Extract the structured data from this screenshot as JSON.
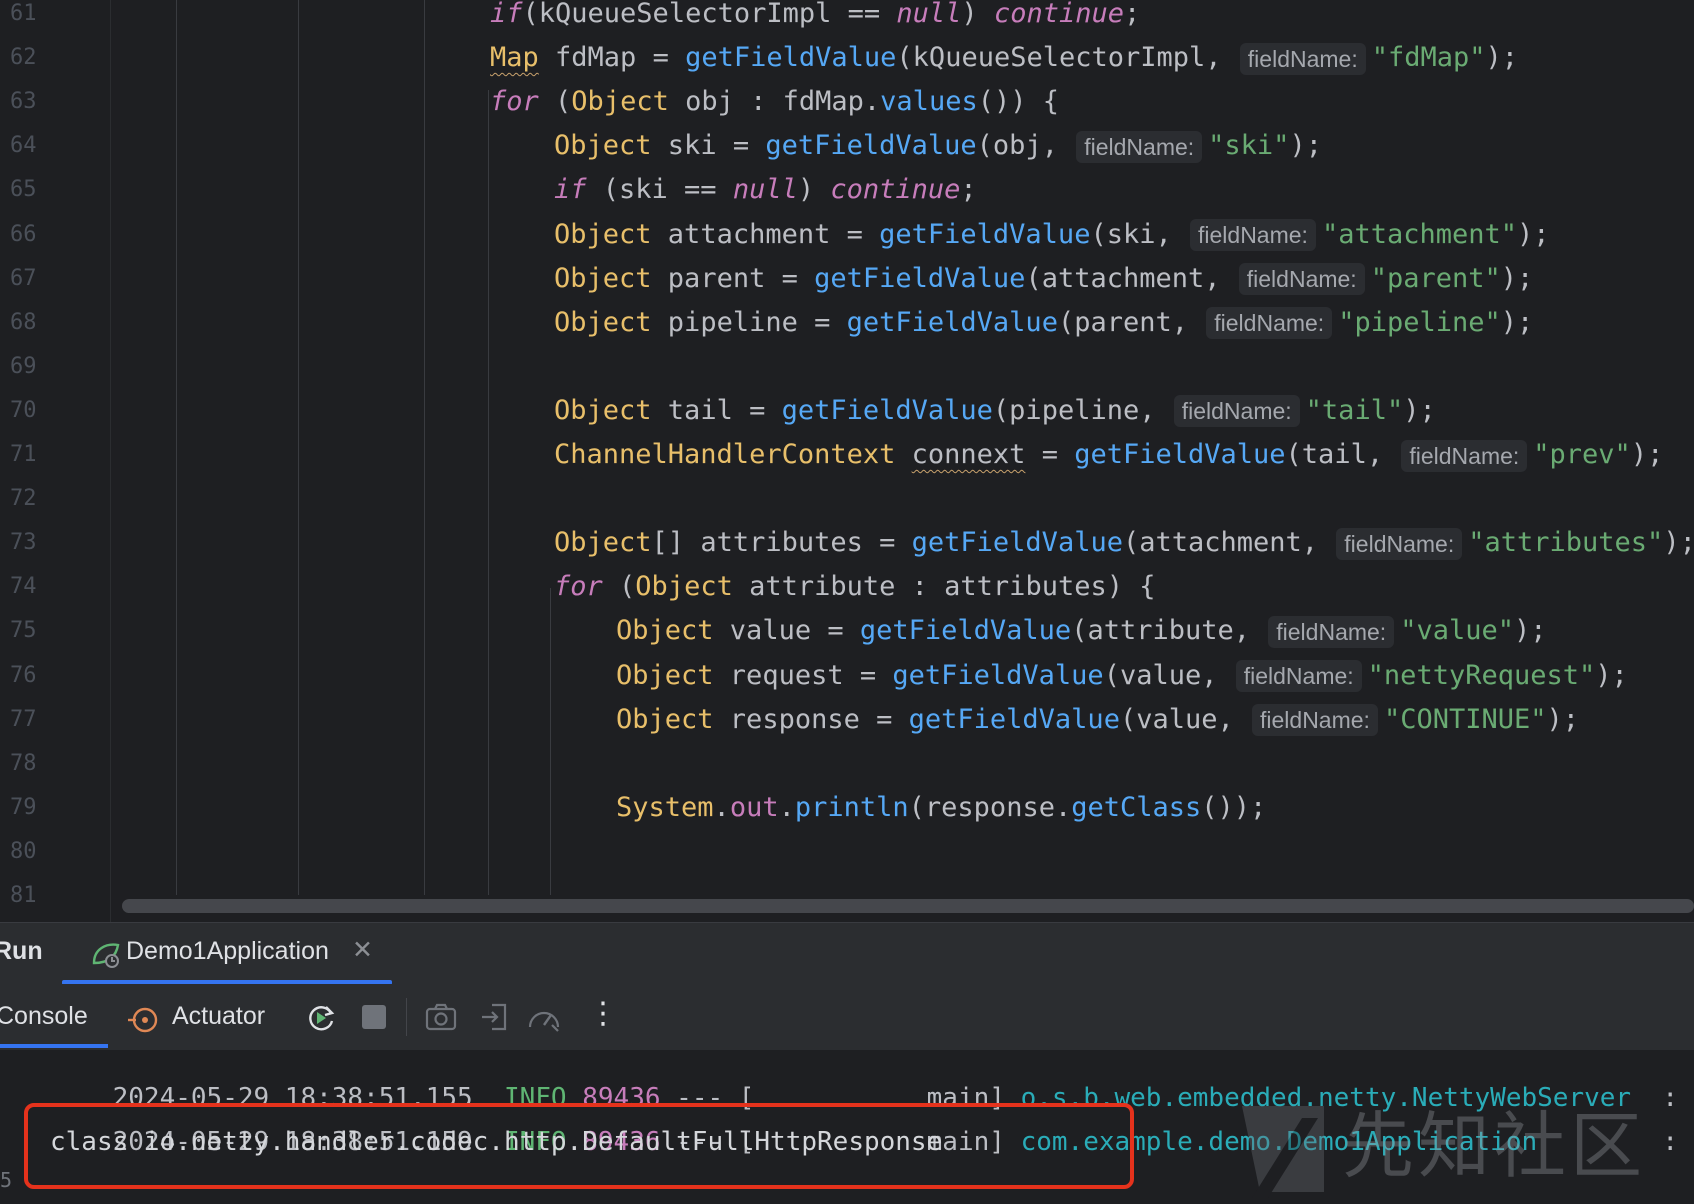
{
  "editor": {
    "lines": [
      {
        "n": "61",
        "parts": [
          [
            "ikw",
            "if"
          ],
          [
            "",
            "(kQueueSelectorImpl == "
          ],
          [
            "ikw",
            "null"
          ],
          [
            "",
            ") "
          ],
          [
            "ikw",
            "continue"
          ],
          [
            "",
            ";"
          ]
        ],
        "indent": 3
      },
      {
        "n": "62",
        "parts": [
          [
            "typ squig",
            "Map"
          ],
          [
            "",
            " fdMap = "
          ],
          [
            "fn",
            "getFieldValue"
          ],
          [
            "",
            "(kQueueSelectorImpl, "
          ],
          [
            "hint",
            "fieldName:"
          ],
          [
            "str",
            "\"fdMap\""
          ],
          [
            "",
            ");"
          ]
        ],
        "indent": 3
      },
      {
        "n": "63",
        "parts": [
          [
            "ikw",
            "for"
          ],
          [
            "",
            " ("
          ],
          [
            "typ",
            "Object"
          ],
          [
            "",
            " obj : fdMap."
          ],
          [
            "fn",
            "values"
          ],
          [
            "",
            "()) {"
          ]
        ],
        "indent": 3
      },
      {
        "n": "64",
        "parts": [
          [
            "typ",
            "Object"
          ],
          [
            "",
            " ski = "
          ],
          [
            "fn",
            "getFieldValue"
          ],
          [
            "",
            "(obj, "
          ],
          [
            "hint",
            "fieldName:"
          ],
          [
            "str",
            "\"ski\""
          ],
          [
            "",
            ");"
          ]
        ],
        "indent": 4
      },
      {
        "n": "65",
        "parts": [
          [
            "ikw",
            "if"
          ],
          [
            "",
            " (ski == "
          ],
          [
            "ikw",
            "null"
          ],
          [
            "",
            ") "
          ],
          [
            "ikw",
            "continue"
          ],
          [
            "",
            ";"
          ]
        ],
        "indent": 4
      },
      {
        "n": "66",
        "parts": [
          [
            "typ",
            "Object"
          ],
          [
            "",
            " attachment = "
          ],
          [
            "fn",
            "getFieldValue"
          ],
          [
            "",
            "(ski, "
          ],
          [
            "hint",
            "fieldName:"
          ],
          [
            "str",
            "\"attachment\""
          ],
          [
            "",
            ");"
          ]
        ],
        "indent": 4
      },
      {
        "n": "67",
        "parts": [
          [
            "typ",
            "Object"
          ],
          [
            "",
            " parent = "
          ],
          [
            "fn",
            "getFieldValue"
          ],
          [
            "",
            "(attachment, "
          ],
          [
            "hint",
            "fieldName:"
          ],
          [
            "str",
            "\"parent\""
          ],
          [
            "",
            ");"
          ]
        ],
        "indent": 4
      },
      {
        "n": "68",
        "parts": [
          [
            "typ",
            "Object"
          ],
          [
            "",
            " pipeline = "
          ],
          [
            "fn",
            "getFieldValue"
          ],
          [
            "",
            "(parent, "
          ],
          [
            "hint",
            "fieldName:"
          ],
          [
            "str",
            "\"pipeline\""
          ],
          [
            "",
            ");"
          ]
        ],
        "indent": 4
      },
      {
        "n": "69",
        "parts": [],
        "indent": 4
      },
      {
        "n": "70",
        "parts": [
          [
            "typ",
            "Object"
          ],
          [
            "",
            " tail = "
          ],
          [
            "fn",
            "getFieldValue"
          ],
          [
            "",
            "(pipeline, "
          ],
          [
            "hint",
            "fieldName:"
          ],
          [
            "str",
            "\"tail\""
          ],
          [
            "",
            ");"
          ]
        ],
        "indent": 4
      },
      {
        "n": "71",
        "parts": [
          [
            "typ",
            "ChannelHandlerContext"
          ],
          [
            "",
            " "
          ],
          [
            "squig",
            "connext"
          ],
          [
            "",
            " = "
          ],
          [
            "fn",
            "getFieldValue"
          ],
          [
            "",
            "(tail, "
          ],
          [
            "hint",
            "fieldName:"
          ],
          [
            "str",
            "\"prev\""
          ],
          [
            "",
            ");"
          ]
        ],
        "indent": 4
      },
      {
        "n": "72",
        "parts": [],
        "indent": 4
      },
      {
        "n": "73",
        "parts": [
          [
            "typ",
            "Object"
          ],
          [
            "",
            "[] attributes = "
          ],
          [
            "fn",
            "getFieldValue"
          ],
          [
            "",
            "(attachment, "
          ],
          [
            "hint",
            "fieldName:"
          ],
          [
            "str",
            "\"attributes\""
          ],
          [
            "",
            ");"
          ]
        ],
        "indent": 4
      },
      {
        "n": "74",
        "parts": [
          [
            "ikw",
            "for"
          ],
          [
            "",
            " ("
          ],
          [
            "typ",
            "Object"
          ],
          [
            "",
            " attribute : attributes) {"
          ]
        ],
        "indent": 4
      },
      {
        "n": "75",
        "parts": [
          [
            "typ",
            "Object"
          ],
          [
            "",
            " value = "
          ],
          [
            "fn",
            "getFieldValue"
          ],
          [
            "",
            "(attribute, "
          ],
          [
            "hint",
            "fieldName:"
          ],
          [
            "str",
            "\"value\""
          ],
          [
            "",
            ");"
          ]
        ],
        "indent": 5
      },
      {
        "n": "76",
        "parts": [
          [
            "typ",
            "Object"
          ],
          [
            "",
            " request = "
          ],
          [
            "fn",
            "getFieldValue"
          ],
          [
            "",
            "(value, "
          ],
          [
            "hint",
            "fieldName:"
          ],
          [
            "str",
            "\"nettyRequest\""
          ],
          [
            "",
            ");"
          ]
        ],
        "indent": 5
      },
      {
        "n": "77",
        "parts": [
          [
            "typ",
            "Object"
          ],
          [
            "",
            " response = "
          ],
          [
            "fn",
            "getFieldValue"
          ],
          [
            "",
            "(value, "
          ],
          [
            "hint",
            "fieldName:"
          ],
          [
            "str",
            "\"CONTINUE\""
          ],
          [
            "",
            ");"
          ]
        ],
        "indent": 5
      },
      {
        "n": "78",
        "parts": [],
        "indent": 5
      },
      {
        "n": "79",
        "parts": [
          [
            "typ",
            "System"
          ],
          [
            "",
            "."
          ],
          [
            "fld",
            "out"
          ],
          [
            "",
            "."
          ],
          [
            "fn",
            "println"
          ],
          [
            "",
            "(response."
          ],
          [
            "fn",
            "getClass"
          ],
          [
            "",
            "());"
          ]
        ],
        "indent": 5
      },
      {
        "n": "80",
        "parts": [],
        "indent": 5
      },
      {
        "n": "81",
        "parts": [],
        "indent": 5
      }
    ]
  },
  "run_panel": {
    "label": "Run",
    "tab_label": "Demo1Application",
    "close_glyph": "✕"
  },
  "toolbar": {
    "console_label": "Console",
    "actuator_label": "Actuator",
    "more_glyph": "⋮"
  },
  "console": {
    "log1": {
      "date": "2024-05-29 18:38:51.155",
      "level": "INFO",
      "pid": "89436",
      "sep": " --- [",
      "thread": "main]",
      "logger": "o.s.b.web.embedded.netty.NettyWebServer",
      "msg": ": Netty"
    },
    "log2": {
      "date": "2024-05-29 18:38:51.159",
      "level": "INFO",
      "pid": "89436",
      "sep": " --- [",
      "thread": "main]",
      "logger": "com.example.demo.Demo1Application",
      "msg": ": Start"
    },
    "output": "class io.netty.handler.codec.http.DefaultFullHttpResponse",
    "gutter_number": "5"
  },
  "watermark": {
    "text": "先知社区"
  },
  "colors": {
    "accent": "#3574f0",
    "highlight_box": "#e5321c",
    "background": "#1e1f22"
  }
}
